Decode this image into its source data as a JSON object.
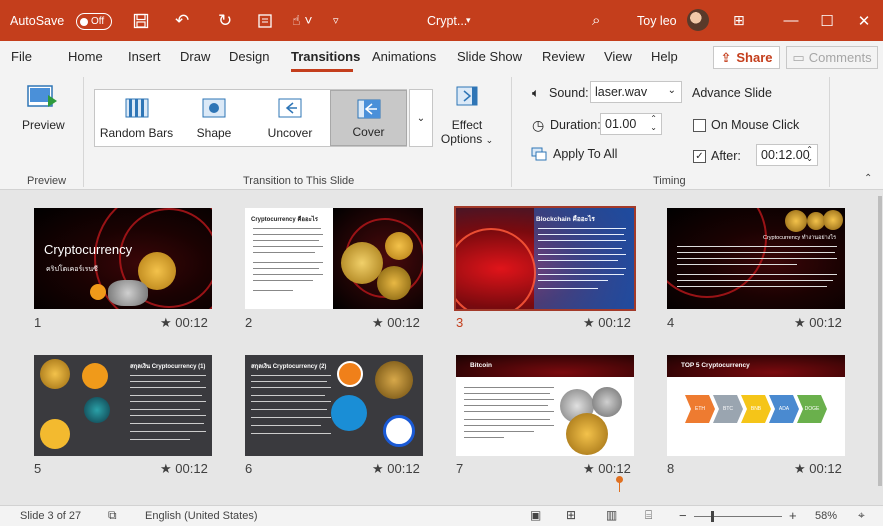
{
  "titlebar": {
    "autosave_label": "AutoSave",
    "autosave_state": "Off",
    "doc_title": "Crypt...",
    "user_name": "Toy leo",
    "accent": "#c43e1c"
  },
  "menu": {
    "tabs": [
      "File",
      "Home",
      "Insert",
      "Draw",
      "Design",
      "Transitions",
      "Animations",
      "Slide Show",
      "Review",
      "View",
      "Help"
    ],
    "active": "Transitions",
    "share_label": "Share",
    "comments_label": "Comments"
  },
  "ribbon": {
    "preview_label": "Preview",
    "preview_group": "Preview",
    "transitions_group": "Transition to This Slide",
    "gallery": [
      "Random Bars",
      "Shape",
      "Uncover",
      "Cover"
    ],
    "gallery_selected": "Cover",
    "effect_options_1": "Effect",
    "effect_options_2": "Options",
    "sound_label": "Sound:",
    "sound_value": "laser.wav",
    "duration_label": "Duration:",
    "duration_value": "01.00",
    "apply_all_label": "Apply To All",
    "advance_label": "Advance Slide",
    "on_mouse_click_label": "On Mouse Click",
    "on_mouse_click_checked": false,
    "after_label": "After:",
    "after_checked": true,
    "after_value": "00:12.00",
    "timing_group": "Timing"
  },
  "slides": [
    {
      "num": "1",
      "time": "00:12",
      "title": "Cryptocurrency",
      "subtitle": "คริปโตเคอร์เรนซี"
    },
    {
      "num": "2",
      "time": "00:12",
      "title": "Cryptocurrency คืออะไร"
    },
    {
      "num": "3",
      "time": "00:12",
      "title": "Blockchain คืออะไร",
      "selected": true
    },
    {
      "num": "4",
      "time": "00:12",
      "title": "Cryptocurrency ทำงานอย่างไร"
    },
    {
      "num": "5",
      "time": "00:12",
      "title": "สกุลเงิน Cryptocurrency (1)"
    },
    {
      "num": "6",
      "time": "00:12",
      "title": "สกุลเงิน Cryptocurrency (2)"
    },
    {
      "num": "7",
      "time": "00:12",
      "title": "Bitcoin"
    },
    {
      "num": "8",
      "time": "00:12",
      "title": "TOP 5 Cryptocurrency",
      "items": [
        "ETH",
        "BTC",
        "BNB",
        "ADA",
        "DOGE"
      ]
    }
  ],
  "statusbar": {
    "slide_info": "Slide 3 of 27",
    "language": "English (United States)",
    "zoom": "58%"
  }
}
